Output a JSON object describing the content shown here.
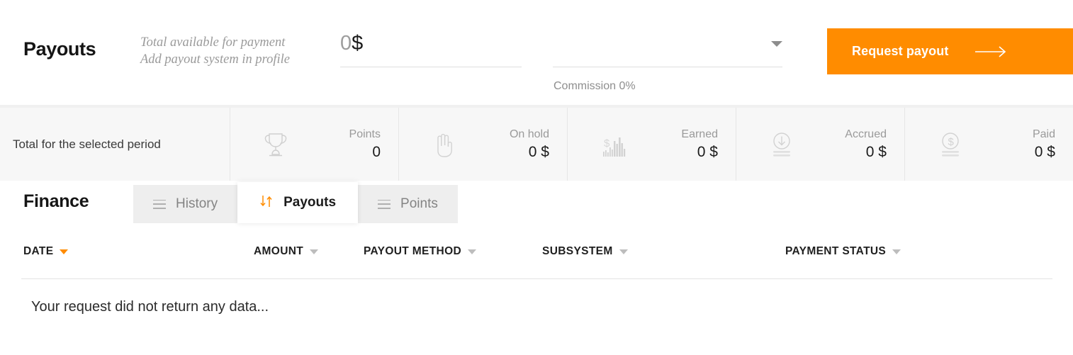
{
  "colors": {
    "accent": "#FF8C00",
    "stats_bg": "#f7f7f7",
    "tab_bg": "#eeeeee",
    "muted": "#9a9a9a"
  },
  "payout_header": {
    "title": "Payouts",
    "subtitle_line1": "Total available for payment",
    "subtitle_line2": "Add payout system in profile",
    "amount": {
      "value": "0",
      "currency": "$",
      "placeholder": "0"
    },
    "method": {
      "value": "",
      "placeholder": "",
      "caret_icon": "chevron-down-icon"
    },
    "commission_note": "Commission 0%",
    "request_button": {
      "label": "Request payout",
      "arrow_icon": "arrow-right-icon"
    }
  },
  "stats": {
    "total_label": "Total for the selected period",
    "cells": [
      {
        "label": "Points",
        "value": "0",
        "icon": "trophy-icon"
      },
      {
        "label": "On hold",
        "value": "0 $",
        "icon": "hand-icon"
      },
      {
        "label": "Earned",
        "value": "0 $",
        "icon": "bar-chart-dollar-icon"
      },
      {
        "label": "Accrued",
        "value": "0 $",
        "icon": "coin-download-icon"
      },
      {
        "label": "Paid",
        "value": "0 $",
        "icon": "coin-dollar-icon"
      }
    ]
  },
  "finance": {
    "title": "Finance",
    "tabs": [
      {
        "label": "History",
        "icon": "list-icon",
        "active": false
      },
      {
        "label": "Payouts",
        "icon": "sort-arrows-icon",
        "active": true
      },
      {
        "label": "Points",
        "icon": "list-icon",
        "active": false
      }
    ],
    "table": {
      "columns": [
        {
          "label": "DATE",
          "sorted": true
        },
        {
          "label": "AMOUNT",
          "sorted": false
        },
        {
          "label": "PAYOUT METHOD",
          "sorted": false
        },
        {
          "label": "SUBSYSTEM",
          "sorted": false
        },
        {
          "label": "PAYMENT STATUS",
          "sorted": false
        }
      ],
      "empty_message": "Your request did not return any data..."
    }
  }
}
